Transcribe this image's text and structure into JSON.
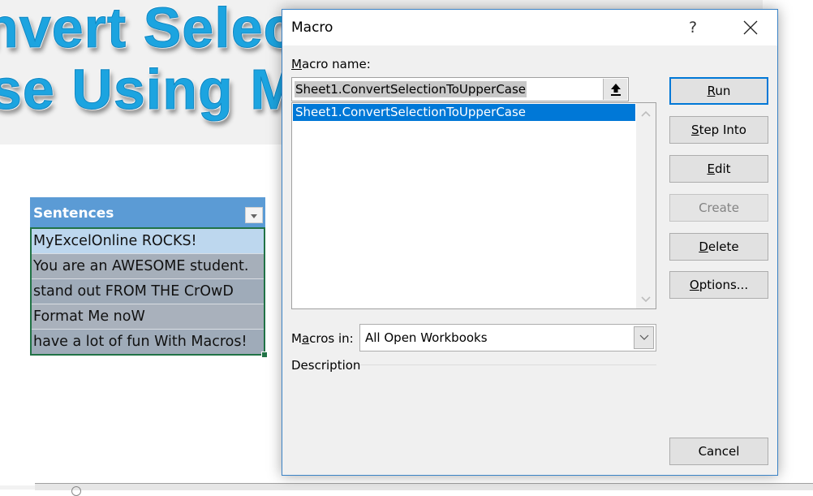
{
  "background": {
    "banner_line1": "nvert Selec",
    "banner_line2": "se Using Ma",
    "banner_color": "#1ca4e0"
  },
  "table": {
    "header": "Sentences",
    "filter_icon": "filter-dropdown-icon",
    "rows": [
      "MyExcelOnline ROCKS!",
      "You are an AWESOME student.",
      "stand out FROM THE CrOwD",
      "Format Me noW",
      "have a lot of fun With Macros!"
    ]
  },
  "dialog": {
    "title": "Macro",
    "help_label": "?",
    "close_icon": "close-icon",
    "macro_name_label_u": "M",
    "macro_name_label_rest": "acro name:",
    "macro_name_value": "Sheet1.ConvertSelectionToUpperCase",
    "upload_icon": "collapse-upload-arrow-icon",
    "macro_list": [
      {
        "label": "Sheet1.ConvertSelectionToUpperCase",
        "selected": true
      }
    ],
    "buttons": {
      "run": {
        "u": "R",
        "rest": "un",
        "state": "default"
      },
      "step_into": {
        "u": "S",
        "rest": "tep Into",
        "state": "enabled"
      },
      "edit": {
        "u": "E",
        "rest": "dit",
        "state": "enabled"
      },
      "create": {
        "u": "",
        "rest": "Create",
        "state": "disabled"
      },
      "delete": {
        "u": "D",
        "rest": "elete",
        "state": "enabled"
      },
      "options": {
        "u": "O",
        "rest": "ptions...",
        "state": "enabled"
      },
      "cancel": {
        "u": "",
        "rest": "Cancel",
        "state": "enabled"
      }
    },
    "macros_in_label_pre": "M",
    "macros_in_label_u": "a",
    "macros_in_label_post": "cros in:",
    "macros_in_value": "All Open Workbooks",
    "description_label": "Description",
    "accent_color": "#0078d7"
  }
}
